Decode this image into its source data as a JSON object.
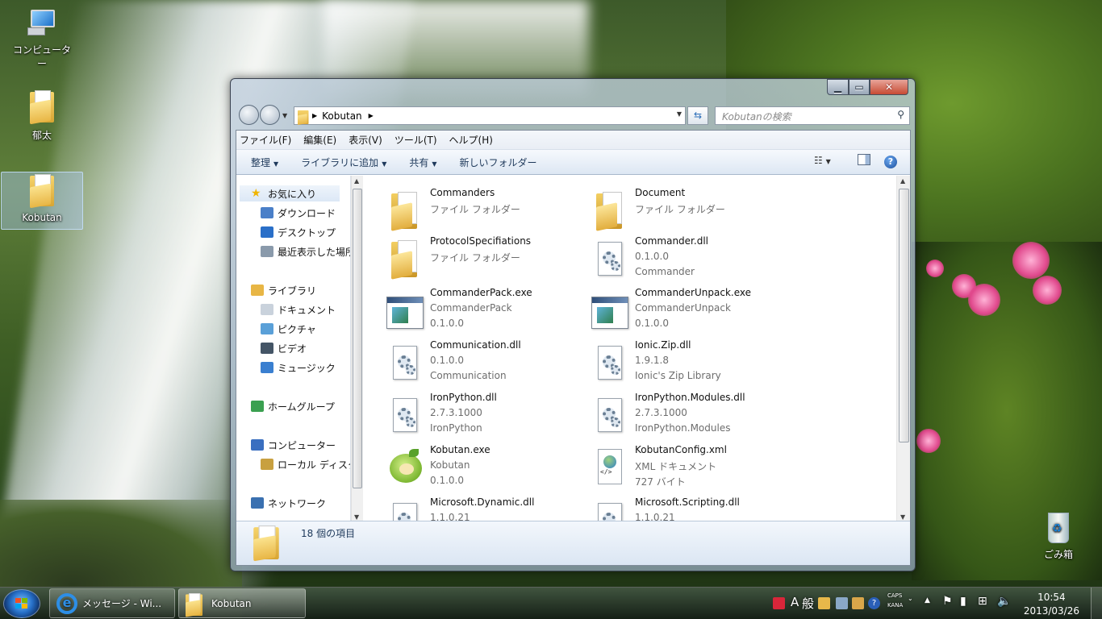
{
  "desktop": {
    "icons": [
      {
        "label": "コンピューター"
      },
      {
        "label": "郁太"
      },
      {
        "label": "Kobutan"
      },
      {
        "label": "ごみ箱"
      }
    ]
  },
  "window": {
    "address": {
      "crumb": "Kobutan"
    },
    "search": {
      "placeholder": "Kobutanの検索"
    },
    "menu": [
      "ファイル(F)",
      "編集(E)",
      "表示(V)",
      "ツール(T)",
      "ヘルプ(H)"
    ],
    "commands": {
      "organize": "整理",
      "add_library": "ライブラリに追加",
      "share": "共有",
      "new_folder": "新しいフォルダー"
    },
    "nav": [
      {
        "label": "お気に入り",
        "icon": "star-icon",
        "group": true
      },
      {
        "label": "ダウンロード",
        "icon": "download-folder-icon"
      },
      {
        "label": "デスクトップ",
        "icon": "desktop-icon"
      },
      {
        "label": "最近表示した場所",
        "icon": "recent-places-icon"
      },
      {
        "label": "ライブラリ",
        "icon": "library-icon",
        "group": true
      },
      {
        "label": "ドキュメント",
        "icon": "documents-icon"
      },
      {
        "label": "ピクチャ",
        "icon": "pictures-icon"
      },
      {
        "label": "ビデオ",
        "icon": "videos-icon"
      },
      {
        "label": "ミュージック",
        "icon": "music-icon"
      },
      {
        "label": "ホームグループ",
        "icon": "homegroup-icon",
        "group": true
      },
      {
        "label": "コンピューター",
        "icon": "computer-icon",
        "group": true
      },
      {
        "label": "ローカル ディスク (C:)",
        "icon": "local-disk-icon"
      },
      {
        "label": "ネットワーク",
        "icon": "network-icon",
        "group": true
      }
    ],
    "files": [
      {
        "name": "Commanders",
        "l2": "ファイル フォルダー",
        "l3": "",
        "kind": "folder"
      },
      {
        "name": "Document",
        "l2": "ファイル フォルダー",
        "l3": "",
        "kind": "folder"
      },
      {
        "name": "ProtocolSpecifiations",
        "l2": "ファイル フォルダー",
        "l3": "",
        "kind": "folder"
      },
      {
        "name": "Commander.dll",
        "l2": "0.1.0.0",
        "l3": "Commander",
        "kind": "dll"
      },
      {
        "name": "CommanderPack.exe",
        "l2": "CommanderPack",
        "l3": "0.1.0.0",
        "kind": "exe"
      },
      {
        "name": "CommanderUnpack.exe",
        "l2": "CommanderUnpack",
        "l3": "0.1.0.0",
        "kind": "exe"
      },
      {
        "name": "Communication.dll",
        "l2": "0.1.0.0",
        "l3": "Communication",
        "kind": "dll"
      },
      {
        "name": "Ionic.Zip.dll",
        "l2": "1.9.1.8",
        "l3": "Ionic's Zip Library",
        "kind": "dll"
      },
      {
        "name": "IronPython.dll",
        "l2": "2.7.3.1000",
        "l3": "IronPython",
        "kind": "dll"
      },
      {
        "name": "IronPython.Modules.dll",
        "l2": "2.7.3.1000",
        "l3": "IronPython.Modules",
        "kind": "dll"
      },
      {
        "name": "Kobutan.exe",
        "l2": "Kobutan",
        "l3": "0.1.0.0",
        "kind": "kobutan"
      },
      {
        "name": "KobutanConfig.xml",
        "l2": "XML ドキュメント",
        "l3": "727 バイト",
        "kind": "xml"
      },
      {
        "name": "Microsoft.Dynamic.dll",
        "l2": "1.1.0.21",
        "l3": "",
        "kind": "dll"
      },
      {
        "name": "Microsoft.Scripting.dll",
        "l2": "1.1.0.21",
        "l3": "",
        "kind": "dll"
      }
    ],
    "status": {
      "item_count": "18 個の項目"
    }
  },
  "taskbar": {
    "buttons": [
      {
        "label": "メッセージ - Wi...",
        "icon": "internet-explorer-icon"
      },
      {
        "label": "Kobutan",
        "icon": "folder-icon"
      }
    ],
    "tray": {
      "ime_mode": "A",
      "ime_label": "般",
      "caps": "CAPS",
      "kana": "KANA"
    },
    "clock": {
      "time": "10:54",
      "date": "2013/03/26"
    }
  },
  "colors": {
    "accent": "#2d6fb8",
    "command_text": "#1e395b",
    "secondary_text": "#6d6d6d",
    "close_button": "#c74a33"
  }
}
